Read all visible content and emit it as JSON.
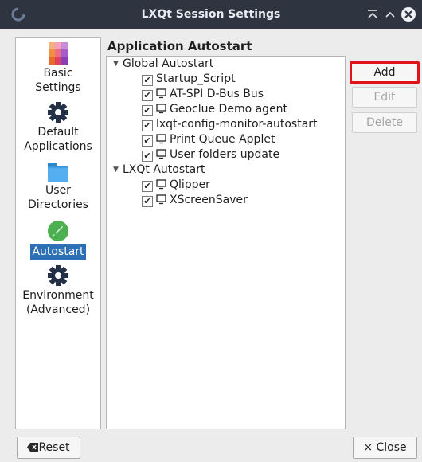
{
  "window": {
    "title": "LXQt Session Settings",
    "controls": [
      "minimize-up-icon",
      "maximize-icon",
      "close-icon"
    ]
  },
  "sidebar": {
    "items": [
      {
        "label1": "Basic",
        "label2": "Settings",
        "icon": "color-palette-icon"
      },
      {
        "label1": "Default",
        "label2": "Applications",
        "icon": "gear-icon"
      },
      {
        "label1": "User",
        "label2": "Directories",
        "icon": "folder-icon"
      },
      {
        "label1": "Autostart",
        "label2": "",
        "icon": "rocket-icon",
        "selected": true
      },
      {
        "label1": "Environment",
        "label2": "(Advanced)",
        "icon": "gear-icon"
      }
    ]
  },
  "main": {
    "title": "Application Autostart",
    "groups": [
      {
        "label": "Global Autostart",
        "items": [
          {
            "label": "Startup_Script",
            "checked": true,
            "monitor": false
          },
          {
            "label": "AT-SPI D-Bus Bus",
            "checked": true,
            "monitor": true
          },
          {
            "label": "Geoclue Demo agent",
            "checked": true,
            "monitor": true
          },
          {
            "label": "lxqt-config-monitor-autostart",
            "checked": true,
            "monitor": false
          },
          {
            "label": "Print Queue Applet",
            "checked": true,
            "monitor": true
          },
          {
            "label": "User folders update",
            "checked": true,
            "monitor": true
          }
        ]
      },
      {
        "label": "LXQt Autostart",
        "items": [
          {
            "label": "Qlipper",
            "checked": true,
            "monitor": true
          },
          {
            "label": "XScreenSaver",
            "checked": true,
            "monitor": true
          }
        ]
      }
    ]
  },
  "buttons": {
    "add": "Add",
    "edit": "Edit",
    "delete": "Delete",
    "reset": "Reset",
    "close": "Close"
  },
  "colors": {
    "highlight_border": "#e0131a",
    "selection": "#2d6fb5"
  }
}
